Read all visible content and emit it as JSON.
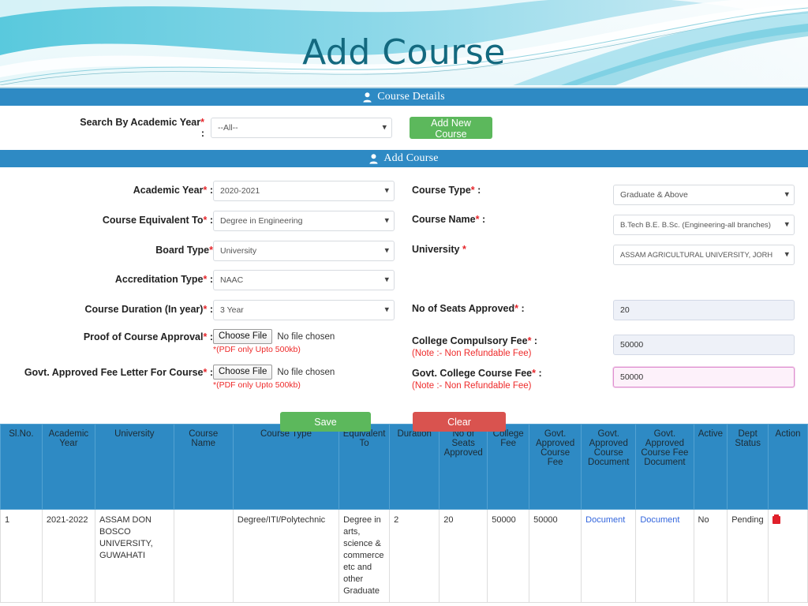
{
  "banner": {
    "title": "Add Course"
  },
  "sections": {
    "course_details": {
      "title": "Course Details",
      "icon": "person-icon"
    },
    "add_course": {
      "title": "Add Course",
      "icon": "person-icon"
    }
  },
  "search_panel": {
    "label": "Search By Academic Year",
    "required_mark": "*",
    "colon": ":",
    "academic_year_value": "--All--",
    "add_new_course_label": "Add New Course"
  },
  "form": {
    "left": {
      "academic_year": {
        "label": "Academic Year",
        "required_mark": "*",
        "colon": ":",
        "value": "2020-2021"
      },
      "course_equivalent_to": {
        "label": "Course Equivalent To",
        "required_mark": "*",
        "colon": ":",
        "value": "Degree in Engineering"
      },
      "board_type": {
        "label": "Board Type",
        "required_mark": "*",
        "colon": "",
        "value": "University"
      },
      "accreditation_type": {
        "label": "Accreditation Type",
        "required_mark": "*",
        "colon": ":",
        "value": "NAAC"
      },
      "course_duration": {
        "label": "Course Duration (In year)",
        "required_mark": "*",
        "colon": ":",
        "value": "3 Year"
      },
      "proof_of_course_approval": {
        "label": "Proof of Course Approval",
        "required_mark": "*",
        "colon": ":",
        "button_label": "Choose File",
        "file_status": "No file chosen",
        "hint": "*(PDF only Upto 500kb)"
      },
      "govt_approved_fee_letter": {
        "label": "Govt. Approved Fee Letter For Course",
        "required_mark": "*",
        "colon": ":",
        "button_label": "Choose File",
        "file_status": "No file chosen",
        "hint": "*(PDF only Upto 500kb)"
      }
    },
    "right": {
      "course_type": {
        "label": "Course Type",
        "required_mark": "*",
        "colon": ":",
        "value": "Graduate & Above"
      },
      "course_name": {
        "label": "Course Name",
        "required_mark": "*",
        "colon": ":",
        "value": "B.Tech B.E. B.Sc. (Engineering-all branches)"
      },
      "university": {
        "label": "University",
        "required_mark": "*",
        "colon": "",
        "value": "ASSAM AGRICULTURAL UNIVERSITY, JORH"
      },
      "no_of_seats_approved": {
        "label": "No of Seats Approved",
        "required_mark": "*",
        "colon": ":",
        "value": "20"
      },
      "college_compulsory_fee": {
        "label": "College Compulsory Fee",
        "required_mark": "*",
        "colon": ":",
        "note": "(Note :- Non Refundable Fee)",
        "value": "50000"
      },
      "govt_college_course_fee": {
        "label": "Govt. College Course Fee",
        "required_mark": "*",
        "colon": ":",
        "note": "(Note :- Non Refundable Fee)",
        "value": "50000",
        "focused": true
      }
    },
    "actions": {
      "save_label": "Save",
      "clear_label": "Clear"
    }
  },
  "table": {
    "headers": [
      "Sl.No.",
      "Academic Year",
      "University",
      "Course Name",
      "Course Type",
      "Equivalent To",
      "Duration",
      "No of Seats Approved",
      "College Fee",
      "Govt. Approved Course Fee",
      "Govt. Approved Course Document",
      "Govt. Approved Course Fee Document",
      "Active",
      "Dept Status",
      "Action"
    ],
    "rows": [
      {
        "sl_no": "1",
        "academic_year": "2021-2022",
        "university": "ASSAM DON BOSCO UNIVERSITY, GUWAHATI",
        "course_name": "",
        "course_type": "Degree/ITI/Polytechnic",
        "equivalent_to": "Degree in arts, science & commerce etc and other Graduate",
        "duration": "2",
        "no_of_seats_approved": "20",
        "college_fee": "50000",
        "govt_approved_course_fee": "50000",
        "govt_approved_course_document": "Document",
        "govt_approved_course_fee_document": "Document",
        "active": "No",
        "dept_status": "Pending",
        "action_icon": "delete-icon"
      }
    ]
  },
  "colors": {
    "section_header_bg": "#2e8ac4",
    "primary_button_green": "#5cb85c",
    "danger_button_red": "#d9534f",
    "required_red": "#e5262b",
    "link_blue": "#3366dd",
    "banner_title": "#13697f"
  }
}
